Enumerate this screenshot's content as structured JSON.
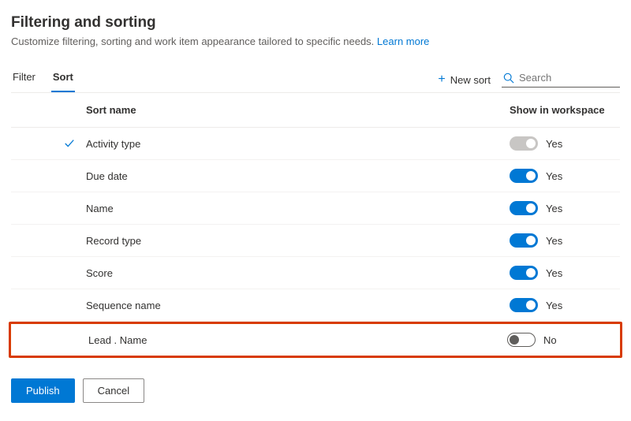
{
  "header": {
    "title": "Filtering and sorting",
    "subtitle": "Customize filtering, sorting and work item appearance tailored to specific needs.",
    "learn_more": "Learn more"
  },
  "tabs": {
    "filter": "Filter",
    "sort": "Sort",
    "active": "sort"
  },
  "toolbar": {
    "new_sort": "New sort",
    "search_placeholder": "Search"
  },
  "table": {
    "col_name": "Sort name",
    "col_workspace": "Show in workspace",
    "rows": [
      {
        "name": "Activity type",
        "enabled": true,
        "disabled_toggle": true,
        "label": "Yes",
        "checked": true
      },
      {
        "name": "Due date",
        "enabled": true,
        "disabled_toggle": false,
        "label": "Yes",
        "checked": false
      },
      {
        "name": "Name",
        "enabled": true,
        "disabled_toggle": false,
        "label": "Yes",
        "checked": false
      },
      {
        "name": "Record type",
        "enabled": true,
        "disabled_toggle": false,
        "label": "Yes",
        "checked": false
      },
      {
        "name": "Score",
        "enabled": true,
        "disabled_toggle": false,
        "label": "Yes",
        "checked": false
      },
      {
        "name": "Sequence name",
        "enabled": true,
        "disabled_toggle": false,
        "label": "Yes",
        "checked": false
      },
      {
        "name": "Lead . Name",
        "enabled": false,
        "disabled_toggle": false,
        "label": "No",
        "checked": false,
        "highlighted": true
      }
    ]
  },
  "footer": {
    "publish": "Publish",
    "cancel": "Cancel"
  }
}
